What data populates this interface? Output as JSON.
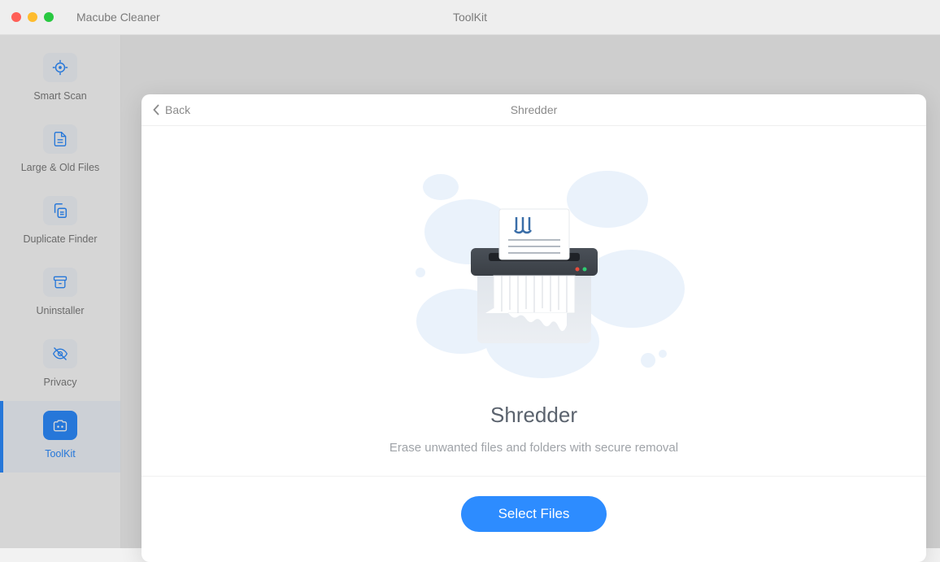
{
  "titlebar": {
    "app_name": "Macube Cleaner",
    "center_title": "ToolKit"
  },
  "sidebar": {
    "items": [
      {
        "label": "Smart Scan"
      },
      {
        "label": "Large & Old Files"
      },
      {
        "label": "Duplicate Finder"
      },
      {
        "label": "Uninstaller"
      },
      {
        "label": "Privacy"
      },
      {
        "label": "ToolKit"
      }
    ]
  },
  "panel": {
    "back_label": "Back",
    "header_title": "Shredder",
    "title": "Shredder",
    "subtitle": "Erase unwanted files and folders with secure removal",
    "select_button": "Select Files"
  },
  "colors": {
    "accent": "#2d8cff"
  }
}
